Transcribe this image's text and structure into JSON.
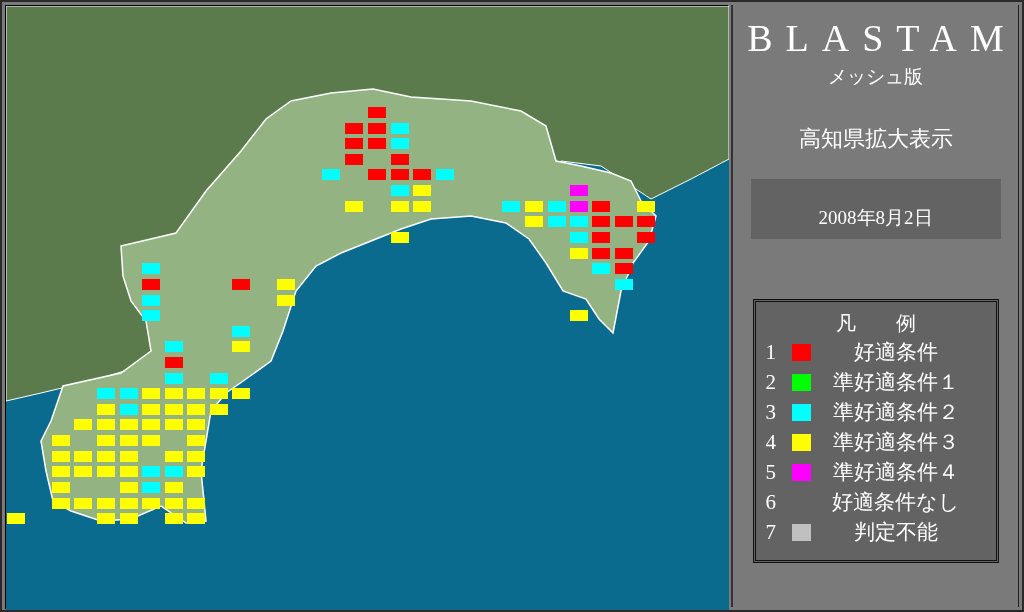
{
  "app": {
    "title": "BLASTAM",
    "subtitle": "メッシュ版"
  },
  "region": "高知県拡大表示",
  "date": "2008年8月2日",
  "legend": {
    "title": "凡　　例",
    "items": [
      {
        "number": "1",
        "label": "好適条件",
        "color": "#ff0000"
      },
      {
        "number": "2",
        "label": "準好適条件１",
        "color": "#00ff00"
      },
      {
        "number": "3",
        "label": "準好適条件２",
        "color": "#00ffff"
      },
      {
        "number": "4",
        "label": "準好適条件３",
        "color": "#ffff00"
      },
      {
        "number": "5",
        "label": "準好適条件４",
        "color": "#ff00ff"
      },
      {
        "number": "6",
        "label": "好適条件なし"
      },
      {
        "number": "7",
        "label": "判定不能",
        "color": "#c0c0c0"
      }
    ]
  }
}
